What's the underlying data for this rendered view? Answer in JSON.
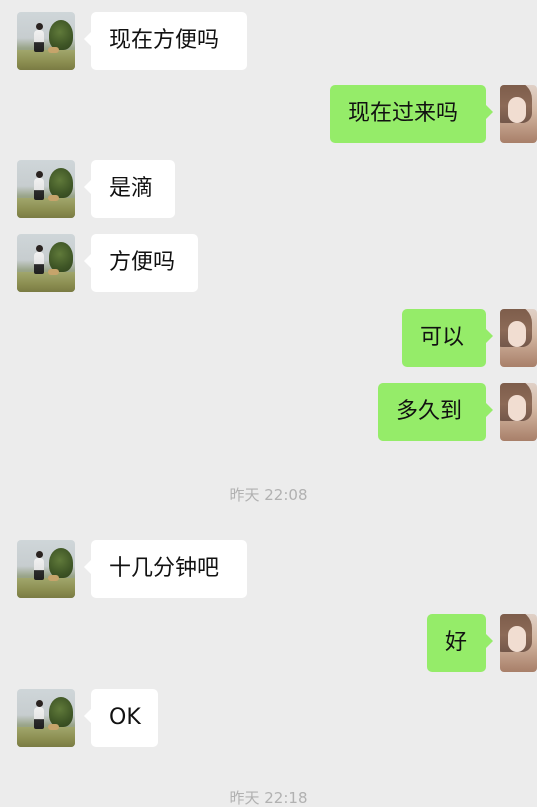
{
  "messages": [
    {
      "side": "left",
      "text": "现在方便吗"
    },
    {
      "side": "right",
      "text": "现在过来吗"
    },
    {
      "side": "left",
      "text": "是滴"
    },
    {
      "side": "left",
      "text": "方便吗"
    },
    {
      "side": "right",
      "text": "可以"
    },
    {
      "side": "right",
      "text": "多久到"
    },
    {
      "side": "left",
      "text": "十几分钟吧"
    },
    {
      "side": "right",
      "text": "好"
    },
    {
      "side": "left",
      "text": "OK"
    }
  ],
  "timestamps": [
    {
      "text": "昨天 22:08"
    },
    {
      "text": "昨天 22:18"
    }
  ],
  "colors": {
    "background": "#ececec",
    "incoming_bubble": "#ffffff",
    "outgoing_bubble": "#95ec69",
    "timestamp_text": "#b1b1b1"
  }
}
